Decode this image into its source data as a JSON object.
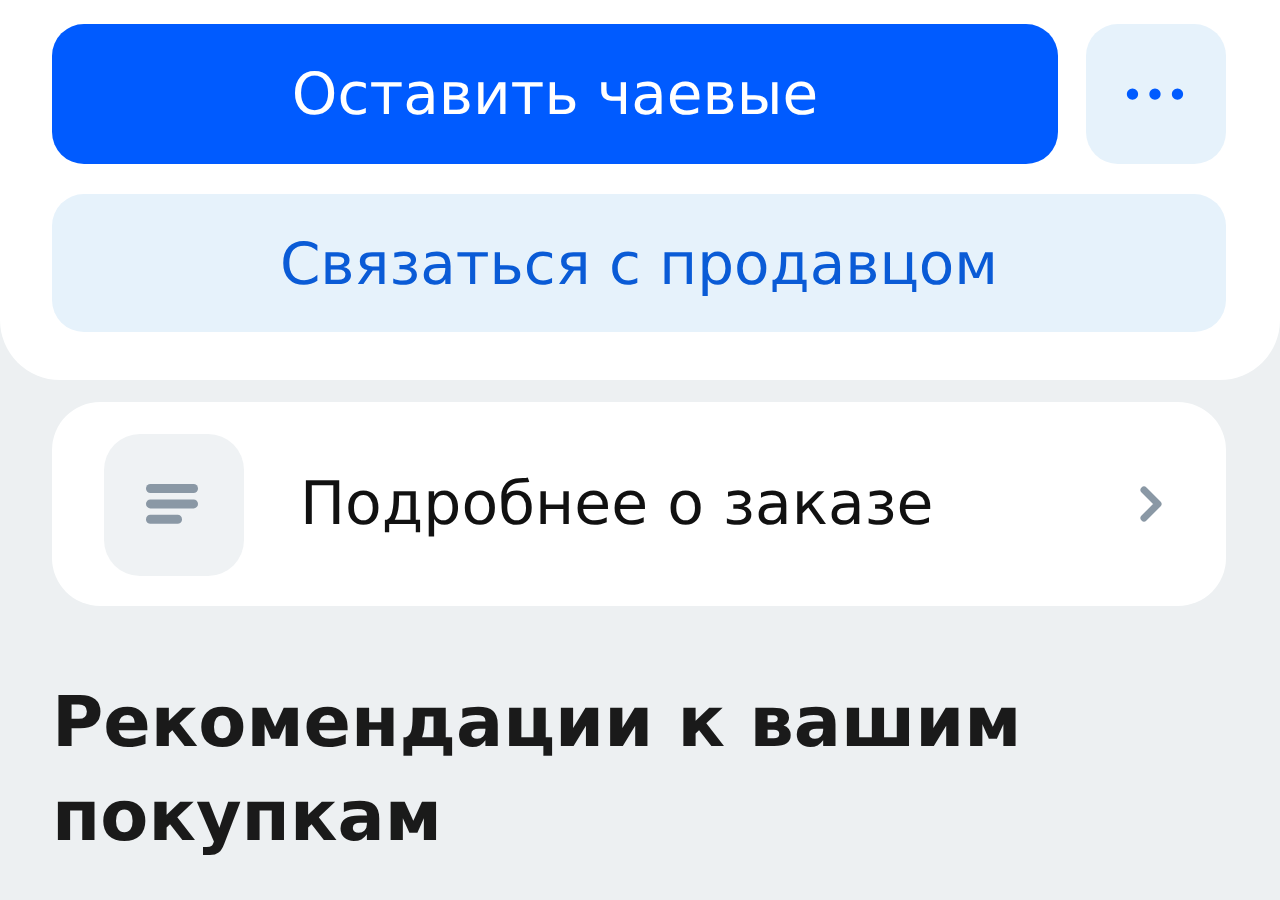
{
  "actions": {
    "primary_button": "Оставить чаевые",
    "more_button": "•••",
    "secondary_button": "Связаться с продавцом"
  },
  "order_details_link": {
    "label": "Подробнее о заказе"
  },
  "section_heading": "Рекомендации к вашим покупкам"
}
